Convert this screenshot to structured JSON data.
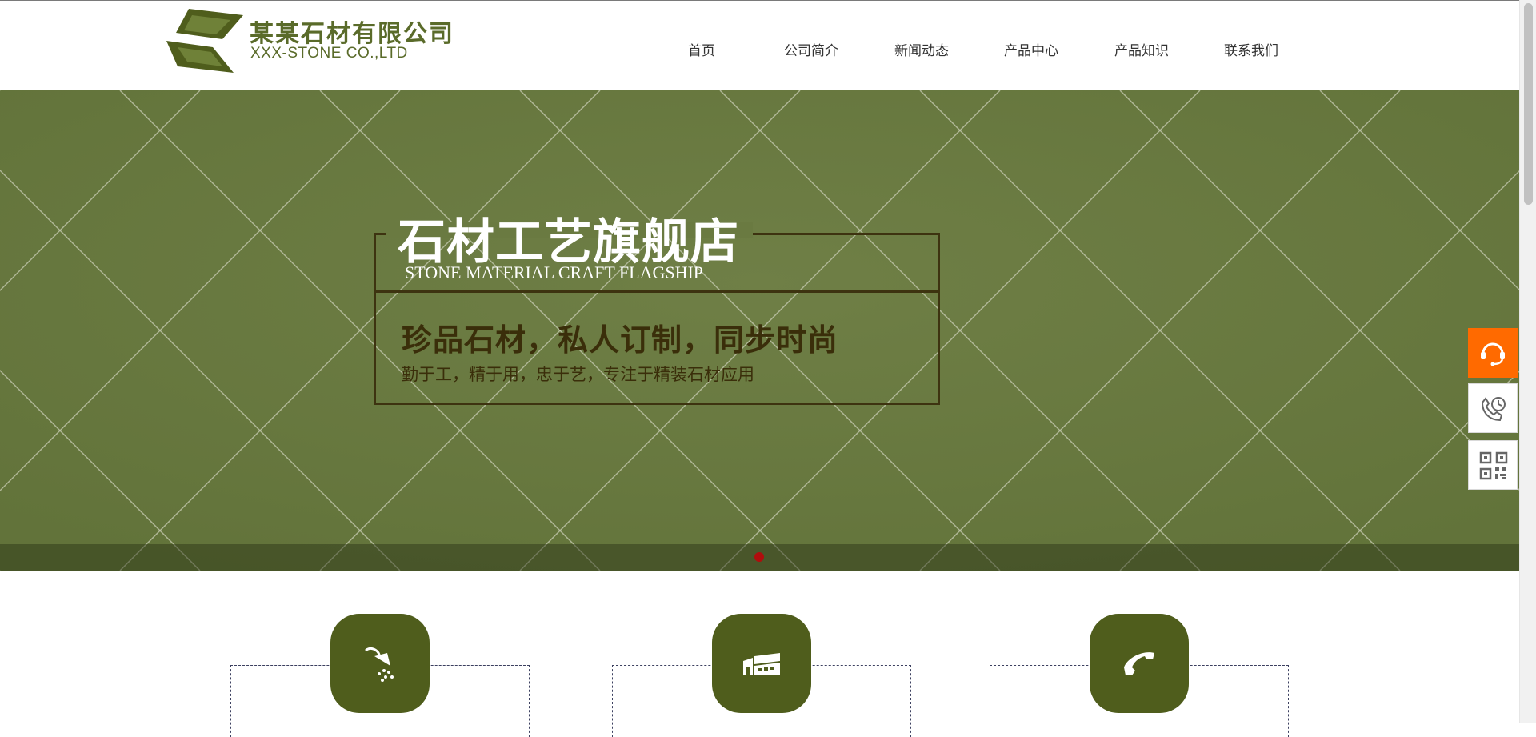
{
  "header": {
    "brand_cn": "某某石材有限公司",
    "brand_en": "XXX-STONE CO.,LTD",
    "logo_icon": "stone-slab-logo"
  },
  "nav": {
    "items": [
      {
        "label": "首页"
      },
      {
        "label": "公司简介"
      },
      {
        "label": "新闻动态"
      },
      {
        "label": "产品中心"
      },
      {
        "label": "产品知识"
      },
      {
        "label": "联系我们"
      }
    ]
  },
  "banner": {
    "title": "石材工艺旗舰店",
    "title_en": "STONE MATERIAL CRAFT FLAGSHIP",
    "slogan": "珍品石材，私人订制，同步时尚",
    "subtitle": "勤于工，精于用，忠于艺，专注于精装石材应用",
    "slide_count": 1,
    "active_slide": 1
  },
  "features": [
    {
      "icon": "shower-icon"
    },
    {
      "icon": "factory-icon"
    },
    {
      "icon": "phone-icon"
    }
  ],
  "floating_tools": [
    {
      "icon": "headset-service-icon"
    },
    {
      "icon": "phone-clock-icon"
    },
    {
      "icon": "qr-code-icon"
    }
  ],
  "colors": {
    "brand_green": "#5a6b2a",
    "banner_green": "#6a7a41",
    "card_green": "#4f5d1c",
    "service_orange": "#ff6a00",
    "slide_dot_red": "#b00d0d",
    "frame_brown": "#3d3310"
  }
}
